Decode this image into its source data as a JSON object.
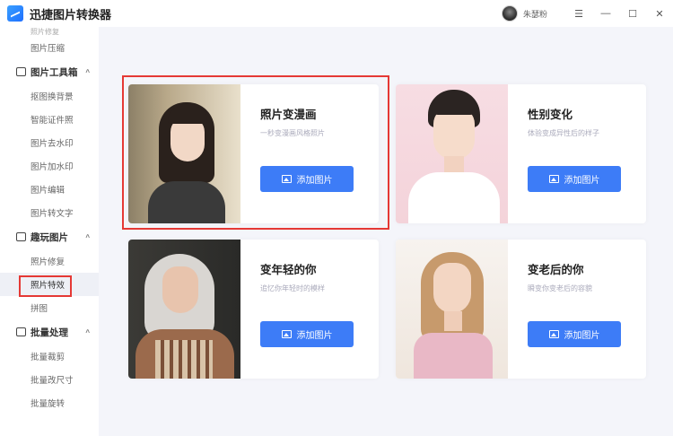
{
  "app": {
    "title": "迅捷图片转换器",
    "user_name": "朱瑟粉",
    "window_controls": [
      "☰",
      "—",
      "☐",
      "✕"
    ]
  },
  "sidebar": {
    "partial_top": "照片修复",
    "items": [
      {
        "type": "sub",
        "label": "图片压缩"
      },
      {
        "type": "group",
        "label": "图片工具箱",
        "icon": "toolbox-icon"
      },
      {
        "type": "sub",
        "label": "抠图换背景"
      },
      {
        "type": "sub",
        "label": "智能证件照"
      },
      {
        "type": "sub",
        "label": "图片去水印"
      },
      {
        "type": "sub",
        "label": "图片加水印"
      },
      {
        "type": "sub",
        "label": "图片编辑"
      },
      {
        "type": "sub",
        "label": "图片转文字"
      },
      {
        "type": "group",
        "label": "趣玩图片",
        "icon": "fun-image-icon"
      },
      {
        "type": "sub",
        "label": "照片修复"
      },
      {
        "type": "sub",
        "label": "照片特效",
        "active": true
      },
      {
        "type": "sub",
        "label": "拼图"
      },
      {
        "type": "group",
        "label": "批量处理",
        "icon": "batch-icon"
      },
      {
        "type": "sub",
        "label": "批量裁剪"
      },
      {
        "type": "sub",
        "label": "批量改尺寸"
      },
      {
        "type": "sub",
        "label": "批量旋转"
      }
    ]
  },
  "cards": [
    {
      "title": "照片变漫画",
      "desc": "一秒变漫画风格照片",
      "button": "添加图片"
    },
    {
      "title": "性别变化",
      "desc": "体验变成异性后的样子",
      "button": "添加图片"
    },
    {
      "title": "变年轻的你",
      "desc": "追忆你年轻时的模样",
      "button": "添加图片"
    },
    {
      "title": "变老后的你",
      "desc": "瞬变你变老后的容貌",
      "button": "添加图片"
    }
  ],
  "colors": {
    "accent": "#3d7cf7",
    "highlight_border": "#e53935"
  }
}
